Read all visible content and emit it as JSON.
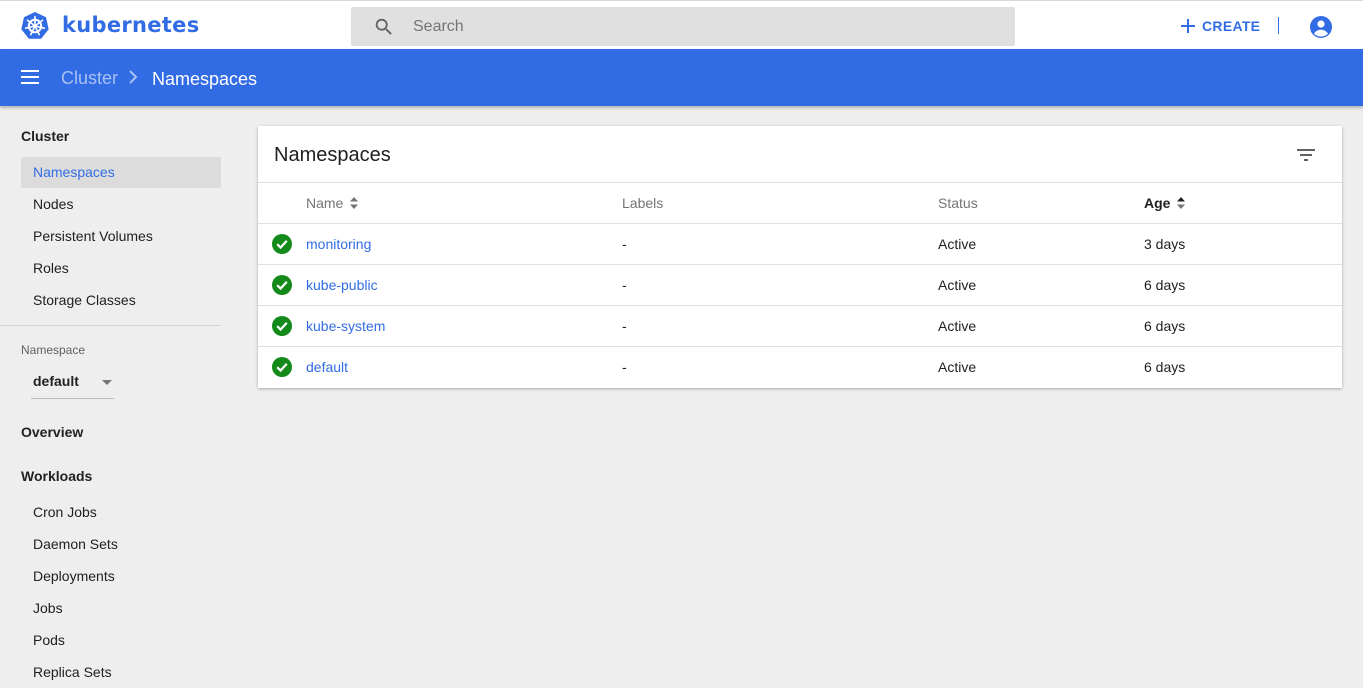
{
  "app": {
    "title": "kubernetes"
  },
  "search": {
    "placeholder": "Search"
  },
  "header": {
    "create_label": "CREATE"
  },
  "breadcrumb": {
    "parent": "Cluster",
    "current": "Namespaces"
  },
  "sidebar": {
    "cluster_heading": "Cluster",
    "cluster_items": [
      {
        "label": "Namespaces",
        "active": true
      },
      {
        "label": "Nodes"
      },
      {
        "label": "Persistent Volumes"
      },
      {
        "label": "Roles"
      },
      {
        "label": "Storage Classes"
      }
    ],
    "namespace_label": "Namespace",
    "namespace_value": "default",
    "overview_heading": "Overview",
    "workloads_heading": "Workloads",
    "workload_items": [
      {
        "label": "Cron Jobs"
      },
      {
        "label": "Daemon Sets"
      },
      {
        "label": "Deployments"
      },
      {
        "label": "Jobs"
      },
      {
        "label": "Pods"
      },
      {
        "label": "Replica Sets"
      }
    ]
  },
  "card": {
    "title": "Namespaces",
    "columns": {
      "name": "Name",
      "labels": "Labels",
      "status": "Status",
      "age": "Age"
    },
    "rows": [
      {
        "name": "monitoring",
        "labels": "-",
        "status": "Active",
        "age": "3 days"
      },
      {
        "name": "kube-public",
        "labels": "-",
        "status": "Active",
        "age": "6 days"
      },
      {
        "name": "kube-system",
        "labels": "-",
        "status": "Active",
        "age": "6 days"
      },
      {
        "name": "default",
        "labels": "-",
        "status": "Active",
        "age": "6 days"
      }
    ]
  },
  "icons": {
    "logo": "kubernetes-wheel-icon",
    "search": "search-icon",
    "create": "plus-icon",
    "account": "account-circle-icon",
    "menu": "hamburger-menu-icon",
    "breadcrumb_separator": "chevron-right-icon",
    "namespace_dropdown": "caret-down-icon",
    "filter": "filter-list-icon",
    "sort": "sort-arrows-icon",
    "row_status": "check-circle-icon"
  },
  "colors": {
    "brand_blue": "#326ce5",
    "status_green": "#138a1a",
    "background": "#eeeeee"
  }
}
